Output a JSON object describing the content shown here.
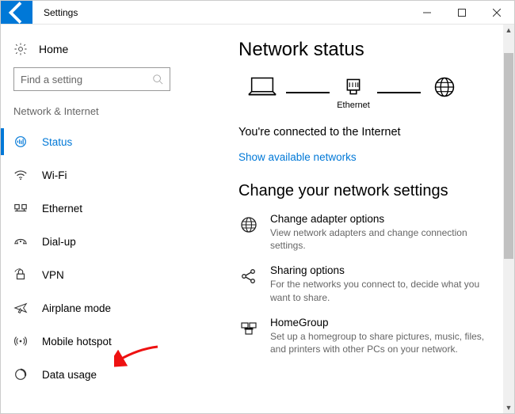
{
  "window": {
    "title": "Settings"
  },
  "sidebar": {
    "home_label": "Home",
    "search_placeholder": "Find a setting",
    "group_header": "Network & Internet",
    "items": [
      {
        "label": "Status",
        "icon": "status"
      },
      {
        "label": "Wi-Fi",
        "icon": "wifi"
      },
      {
        "label": "Ethernet",
        "icon": "ethernet"
      },
      {
        "label": "Dial-up",
        "icon": "dialup"
      },
      {
        "label": "VPN",
        "icon": "vpn"
      },
      {
        "label": "Airplane mode",
        "icon": "airplane"
      },
      {
        "label": "Mobile hotspot",
        "icon": "hotspot"
      },
      {
        "label": "Data usage",
        "icon": "datausage"
      }
    ]
  },
  "main": {
    "heading": "Network status",
    "diagram": {
      "ethernet_label": "Ethernet"
    },
    "status_line": "You're connected to the Internet",
    "show_networks": "Show available networks",
    "settings_heading": "Change your network settings",
    "items": [
      {
        "title": "Change adapter options",
        "desc": "View network adapters and change connection settings."
      },
      {
        "title": "Sharing options",
        "desc": "For the networks you connect to, decide what you want to share."
      },
      {
        "title": "HomeGroup",
        "desc": "Set up a homegroup to share pictures, music, files, and printers with other PCs on your network."
      }
    ]
  }
}
